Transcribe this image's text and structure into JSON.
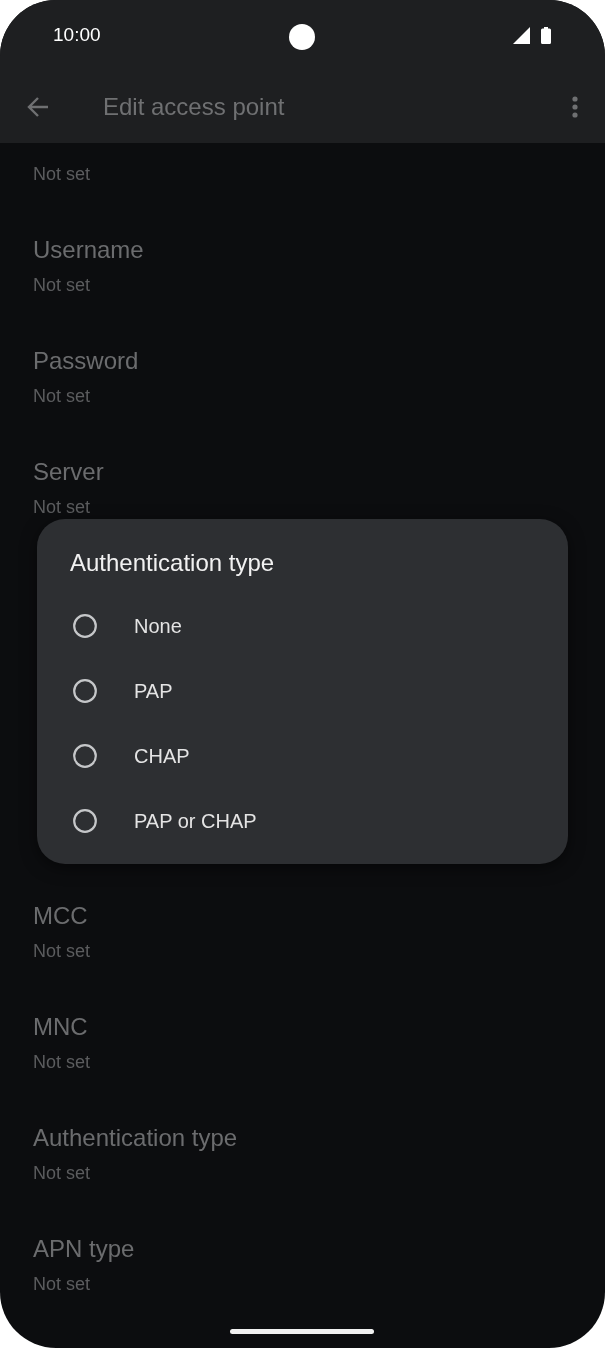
{
  "status_bar": {
    "time": "10:00"
  },
  "app_bar": {
    "title": "Edit access point"
  },
  "settings": {
    "above_dialog": [
      {
        "value": "Not set"
      },
      {
        "title": "Username",
        "value": "Not set"
      },
      {
        "title": "Password",
        "value": "Not set"
      },
      {
        "title": "Server",
        "value": "Not set"
      }
    ],
    "below_dialog": [
      {
        "title": "MCC",
        "value": "Not set"
      },
      {
        "title": "MNC",
        "value": "Not set"
      },
      {
        "title": "Authentication type",
        "value": "Not set"
      },
      {
        "title": "APN type",
        "value": "Not set"
      }
    ]
  },
  "dialog": {
    "title": "Authentication type",
    "options": [
      {
        "label": "None",
        "selected": false
      },
      {
        "label": "PAP",
        "selected": false
      },
      {
        "label": "CHAP",
        "selected": false
      },
      {
        "label": "PAP or CHAP",
        "selected": false
      }
    ]
  }
}
